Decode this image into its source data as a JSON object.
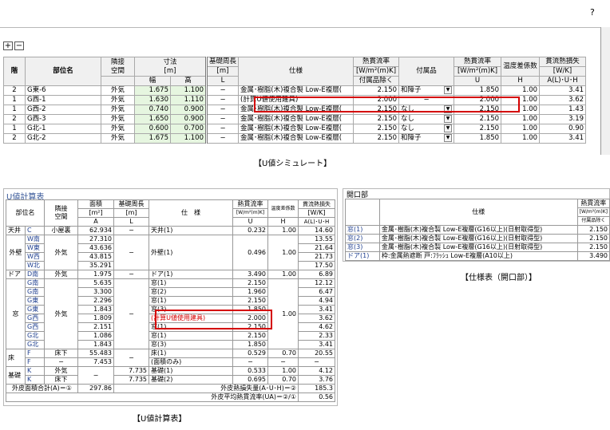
{
  "help": "?",
  "toolbar": {
    "expand": "+",
    "collapse": "−"
  },
  "top_table": {
    "headers": {
      "floor": "階",
      "name": "部位名",
      "adjacent_1": "隣接",
      "adjacent_2": "空間",
      "dim_1": "寸法",
      "dim_2": "[m]",
      "width": "幅",
      "height": "高",
      "len_1": "基礎周長",
      "len_2": "[m]",
      "len_3": "L",
      "spec": "仕様",
      "u1_1": "熱貫流率",
      "u1_2": "[W/m²(m)K]",
      "u1_3": "付属品除く",
      "acc": "付属品",
      "u2_1": "熱貫流率",
      "u2_2": "[W/m²(m)K]",
      "u2_3": "U",
      "h_1": "温度差係数",
      "h_2": "H",
      "loss_1": "貫流熱損失",
      "loss_2": "[W/K]",
      "loss_3": "A(L)･U･H"
    },
    "rows": [
      {
        "floor": "2",
        "name": "G東-6",
        "adj": "外気",
        "w": "1.675",
        "h": "1.100",
        "len": "−",
        "spec": "金属･樹脂(木)複合製 Low-E複層(",
        "u1": "2.150",
        "acc": "和障子",
        "u2": "1.850",
        "hh": "1.00",
        "loss": "3.41"
      },
      {
        "floor": "1",
        "name": "G西-1",
        "adj": "外気",
        "w": "1.630",
        "h": "1.110",
        "len": "−",
        "spec": "(計算U値使用建具)",
        "u1": "2.000",
        "acc": "−",
        "u2": "2.000",
        "hh": "1.00",
        "loss": "3.62"
      },
      {
        "floor": "1",
        "name": "G西-2",
        "adj": "外気",
        "w": "0.740",
        "h": "0.900",
        "len": "−",
        "spec": "金属･樹脂(木)複合製 Low-E複層(",
        "u1": "2.150",
        "acc": "なし",
        "u2": "2.150",
        "hh": "1.00",
        "loss": "1.43"
      },
      {
        "floor": "2",
        "name": "G西-3",
        "adj": "外気",
        "w": "1.650",
        "h": "0.900",
        "len": "−",
        "spec": "金属･樹脂(木)複合製 Low-E複層(",
        "u1": "2.150",
        "acc": "なし",
        "u2": "2.150",
        "hh": "1.00",
        "loss": "3.19"
      },
      {
        "floor": "1",
        "name": "G北-1",
        "adj": "外気",
        "w": "0.600",
        "h": "0.700",
        "len": "−",
        "spec": "金属･樹脂(木)複合製 Low-E複層(",
        "u1": "2.150",
        "acc": "なし",
        "u2": "2.150",
        "hh": "1.00",
        "loss": "0.90"
      },
      {
        "floor": "2",
        "name": "G北-2",
        "adj": "外気",
        "w": "1.675",
        "h": "1.100",
        "len": "−",
        "spec": "金属･樹脂(木)複合製 Low-E複層(",
        "u1": "2.150",
        "acc": "和障子",
        "u2": "1.850",
        "hh": "1.00",
        "loss": "3.41"
      }
    ]
  },
  "captions": {
    "sim": "【U値シミュレート】",
    "calc": "【U値計算表】",
    "spec": "【仕様表（開口部）】"
  },
  "calc_table": {
    "title": "U値計算表",
    "headers": {
      "name": "部位名",
      "adj_1": "隣接",
      "adj_2": "空間",
      "area_1": "面積",
      "area_2": "[m²]",
      "area_3": "A",
      "len_1": "基礎周長",
      "len_2": "[m]",
      "len_3": "L",
      "spec": "仕　様",
      "u_1": "熱貫流率",
      "u_2": "[W/m²(m)K]",
      "u_3": "U",
      "h_1": "温度差係数",
      "h_2": "H",
      "loss_1": "貫流熱損失",
      "loss_2": "[W/K]",
      "loss_3": "A(L)･U･H"
    },
    "rows": [
      {
        "g": "天井",
        "s": "C",
        "adj": "小屋裏",
        "a": "62.934",
        "l": "−",
        "spec": "天井(1)",
        "u": "0.232",
        "h": "1.00",
        "loss": "14.60"
      },
      {
        "g": "",
        "s": "W南",
        "adj": "",
        "a": "27.310",
        "l": "",
        "spec": "",
        "u": "",
        "h": "",
        "loss": "13.55"
      },
      {
        "g": "外壁",
        "s": "W東",
        "adj": "外気",
        "a": "43.636",
        "l": "−",
        "spec": "外壁(1)",
        "u": "0.496",
        "h": "1.00",
        "loss": "21.64"
      },
      {
        "g": "",
        "s": "W西",
        "adj": "",
        "a": "43.815",
        "l": "",
        "spec": "",
        "u": "",
        "h": "",
        "loss": "21.73"
      },
      {
        "g": "",
        "s": "W北",
        "adj": "",
        "a": "35.291",
        "l": "",
        "spec": "",
        "u": "",
        "h": "",
        "loss": "17.50"
      },
      {
        "g": "ドア",
        "s": "D南",
        "adj": "外気",
        "a": "1.975",
        "l": "−",
        "spec": "ドア(1)",
        "u": "3.490",
        "h": "1.00",
        "loss": "6.89"
      },
      {
        "g": "",
        "s": "G南",
        "adj": "",
        "a": "5.635",
        "l": "",
        "spec": "窓(1)",
        "u": "2.150",
        "h": "",
        "loss": "12.12"
      },
      {
        "g": "",
        "s": "G南",
        "adj": "",
        "a": "3.300",
        "l": "",
        "spec": "窓(2)",
        "u": "1.960",
        "h": "",
        "loss": "6.47"
      },
      {
        "g": "",
        "s": "G東",
        "adj": "",
        "a": "2.296",
        "l": "",
        "spec": "窓(1)",
        "u": "2.150",
        "h": "",
        "loss": "4.94"
      },
      {
        "g": "窓",
        "s": "G東",
        "adj": "外気",
        "a": "1.843",
        "l": "−",
        "spec": "窓(3)",
        "u": "1.850",
        "h": "1.00",
        "loss": "3.41"
      },
      {
        "g": "",
        "s": "G西",
        "adj": "",
        "a": "1.809",
        "l": "",
        "spec": "(計算U値使用建具)",
        "u": "2.000",
        "h": "",
        "loss": "3.62"
      },
      {
        "g": "",
        "s": "G西",
        "adj": "",
        "a": "2.151",
        "l": "",
        "spec": "窓(1)",
        "u": "2.150",
        "h": "",
        "loss": "4.62"
      },
      {
        "g": "",
        "s": "G北",
        "adj": "",
        "a": "1.086",
        "l": "",
        "spec": "窓(1)",
        "u": "2.150",
        "h": "",
        "loss": "2.33"
      },
      {
        "g": "",
        "s": "G北",
        "adj": "",
        "a": "1.843",
        "l": "",
        "spec": "窓(3)",
        "u": "1.850",
        "h": "",
        "loss": "3.41"
      },
      {
        "g": "床",
        "s": "F",
        "adj": "床下",
        "a": "55.483",
        "l": "−",
        "spec": "床(1)",
        "u": "0.529",
        "h": "0.70",
        "loss": "20.55"
      },
      {
        "g": "",
        "s": "F",
        "adj": "−",
        "a": "7.453",
        "l": "",
        "spec": "(面積のみ)",
        "u": "−",
        "h": "−",
        "loss": "−"
      },
      {
        "g": "基礎",
        "s": "K",
        "adj": "外気",
        "a": "−",
        "l": "7.735",
        "spec": "基礎(1)",
        "u": "0.533",
        "h": "1.00",
        "loss": "4.12"
      },
      {
        "g": "",
        "s": "K",
        "adj": "床下",
        "a": "",
        "l": "7.735",
        "spec": "基礎(2)",
        "u": "0.695",
        "h": "0.70",
        "loss": "3.76"
      }
    ],
    "footer": {
      "area_label": "外皮面積合計(A)＝①",
      "area_value": "297.86",
      "loss_label": "外皮熱損失量(A･U･H)＝②",
      "loss_value": "185.3",
      "ua_label": "外皮平均熱貫流率(UA)＝②/①",
      "ua_value": "0.56"
    }
  },
  "spec_table": {
    "title": "開口部",
    "headers": {
      "spec": "仕様",
      "u_1": "熱貫流率",
      "u_2": "[W/m²(m)K]",
      "u_3": "付属品除く"
    },
    "rows": [
      {
        "name": "窓(1)",
        "spec": "金属･樹脂(木)複合製 Low-E複層(G16以上)(日射取得型)",
        "u": "2.150"
      },
      {
        "name": "窓(2)",
        "spec": "金属･樹脂(木)複合製 Low-E複層(G16以上)(日射取得型)",
        "u": "2.150"
      },
      {
        "name": "窓(3)",
        "spec": "金属･樹脂(木)複合製 Low-E複層(G16以上)(日射取得型)",
        "u": "2.150"
      },
      {
        "name": "ドア(1)",
        "spec": "枠:金属熱遮断 戸:ﾌﾗｯｼｭ Low-E複層(A10以上)",
        "u": "3.490"
      }
    ]
  }
}
